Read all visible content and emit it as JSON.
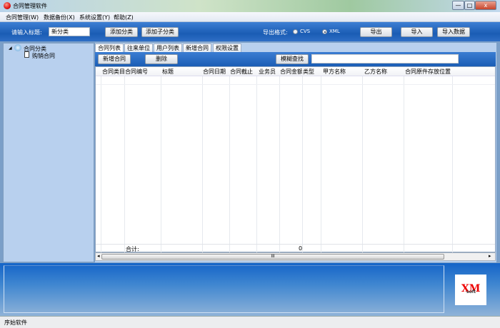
{
  "window": {
    "title": "合同管理软件",
    "minimize": "—",
    "maximize": "□",
    "close": "x"
  },
  "menu": [
    "合同管理(W)",
    "数据备份(X)",
    "系统设置(Y)",
    "帮助(Z)"
  ],
  "toolbar": {
    "title_label": "请输入标题:",
    "title_value": "新分类",
    "add_category": "添加分类",
    "add_subcategory": "添加子分类",
    "export_format_label": "导出格式:",
    "format_options": [
      "CVS",
      "XML"
    ],
    "selected_format": "XML",
    "export": "导出",
    "import": "导入",
    "import_data": "导入数据"
  },
  "tree": {
    "root": "合同分类",
    "children": [
      "购销合同"
    ]
  },
  "tabs": [
    "合同列表",
    "往来单位",
    "用户列表",
    "新增合同",
    "权限设置"
  ],
  "active_tab": "合同列表",
  "grid_toolbar": {
    "new_contract": "新增合同",
    "delete": "删除",
    "fuzzy_search": "模糊查找",
    "search_value": ""
  },
  "table": {
    "columns": [
      "合同类目",
      "合同编号",
      "标题",
      "合同日期",
      "合同截止",
      "业务员",
      "合同金额",
      "类型",
      "甲方名称",
      "乙方名称",
      "合同原件存放位置"
    ],
    "rows": [],
    "total_label": "合计:",
    "total_amount": "0"
  },
  "scrollbar": {
    "thumb_glyph": "III",
    "left_arrow": "◂",
    "right_arrow": "▸"
  },
  "logo": {
    "text": "XM",
    "subtext": "soft"
  },
  "status": {
    "text": "序始软件"
  }
}
